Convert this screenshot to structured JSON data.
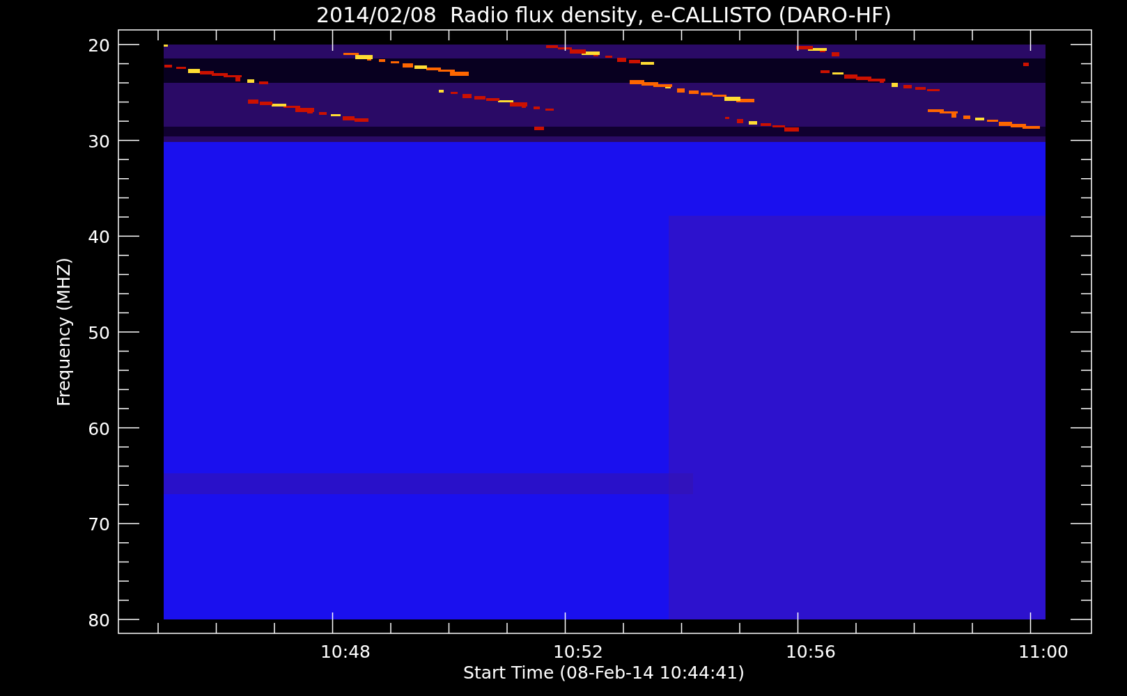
{
  "title": "2014/02/08  Radio flux density, e-CALLISTO (DARO-HF)",
  "y_axis": {
    "label": "Frequency (MHZ)",
    "ticks": [
      "20",
      "30",
      "40",
      "50",
      "60",
      "70",
      "80"
    ]
  },
  "x_axis": {
    "label": "Start Time (08-Feb-14 10:44:41)",
    "ticks": [
      "10:48",
      "10:52",
      "10:56",
      "11:00"
    ]
  }
}
